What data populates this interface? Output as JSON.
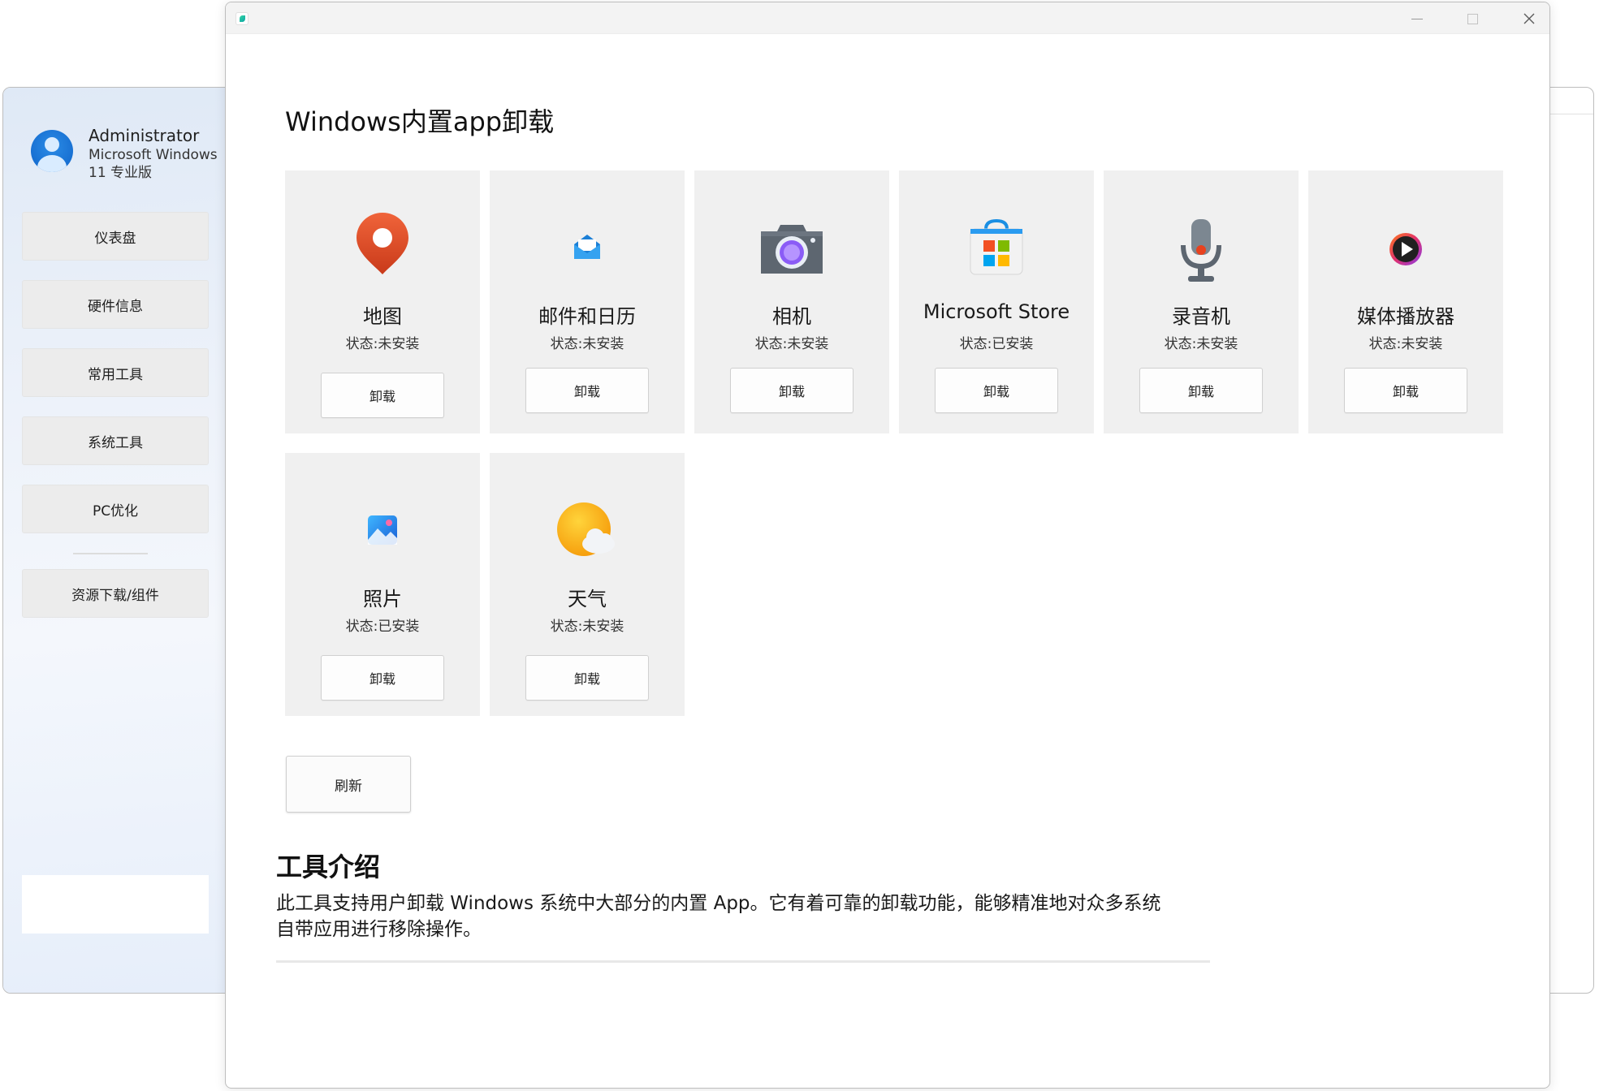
{
  "profile": {
    "name": "Administrator",
    "os": "Microsoft Windows 11 专业版"
  },
  "nav": {
    "items": [
      "仪表盘",
      "硬件信息",
      "常用工具",
      "系统工具",
      "PC优化"
    ],
    "resources": "资源下载/组件"
  },
  "page": {
    "title": "Windows内置app卸载"
  },
  "apps": [
    {
      "name": "地图",
      "status": "状态:未安装",
      "button": "卸载",
      "icon": "maps-pin-icon"
    },
    {
      "name": "邮件和日历",
      "status": "状态:未安装",
      "button": "卸载",
      "icon": "mail-envelope-icon"
    },
    {
      "name": "相机",
      "status": "状态:未安装",
      "button": "卸载",
      "icon": "camera-icon"
    },
    {
      "name": "Microsoft Store",
      "status": "状态:已安装",
      "button": "卸载",
      "icon": "store-bag-icon"
    },
    {
      "name": "录音机",
      "status": "状态:未安装",
      "button": "卸载",
      "icon": "microphone-icon"
    },
    {
      "name": "媒体播放器",
      "status": "状态:未安装",
      "button": "卸载",
      "icon": "media-play-icon"
    },
    {
      "name": "照片",
      "status": "状态:已安装",
      "button": "卸载",
      "icon": "photos-icon"
    },
    {
      "name": "天气",
      "status": "状态:未安装",
      "button": "卸载",
      "icon": "weather-sun-cloud-icon"
    }
  ],
  "actions": {
    "refresh": "刷新"
  },
  "intro": {
    "title": "工具介绍",
    "text": "此工具支持用户卸载 Windows 系统中大部分的内置 App。它有着可靠的卸载功能，能够精准地对众多系统自带应用进行移除操作。"
  },
  "colors": {
    "card_bg": "#f0f0f0",
    "accent": "#0f63c9"
  }
}
